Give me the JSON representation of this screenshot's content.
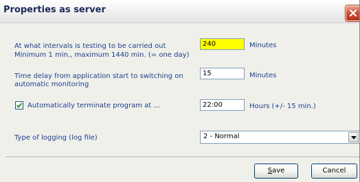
{
  "window": {
    "title": "Properties as server",
    "close_label": "Close"
  },
  "interval": {
    "label_line1": "At what intervals is testing to be carried out",
    "label_line2": "Minimum 1 min.,  maximum 1440 min. (= one day)",
    "value": "240",
    "unit": "Minutes"
  },
  "delay": {
    "label_line1": "Time delay from application start to switching on",
    "label_line2": "automatic monitoring",
    "value": "15",
    "unit": "Minutes"
  },
  "terminate": {
    "checked": true,
    "label": "Automatically terminate program at ...",
    "value": "22:00",
    "unit": "Hours (+/- 15 min.)"
  },
  "logging": {
    "label": "Type of logging (log file)",
    "selected": "2 - Normal"
  },
  "buttons": {
    "save_first": "S",
    "save_rest": "ave",
    "cancel": "Cancel"
  }
}
